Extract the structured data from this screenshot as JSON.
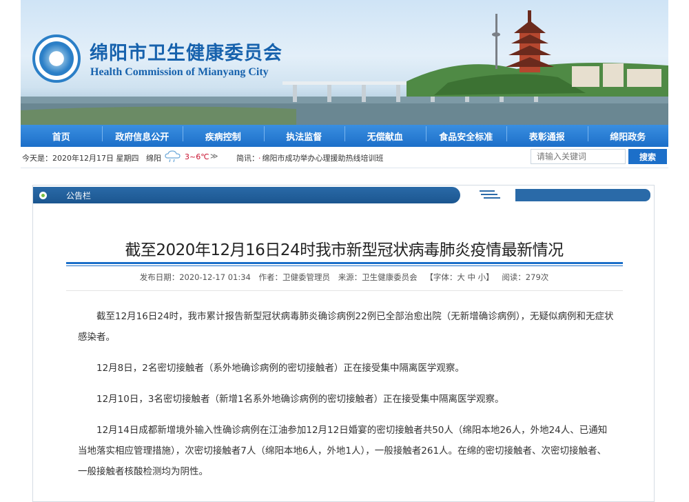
{
  "header": {
    "title_cn": "绵阳市卫生健康委员会",
    "title_en": "Health Commission of Mianyang City"
  },
  "nav": {
    "items": [
      "首页",
      "政府信息公开",
      "疾病控制",
      "执法监督",
      "无偿献血",
      "食品安全标准",
      "表彰通报",
      "绵阳政务"
    ]
  },
  "infobar": {
    "date": "今天是：2020年12月17日 星期四",
    "city": "绵阳",
    "temperature": "3~6℃",
    "more": "≫",
    "news_label": "简讯：",
    "news_text": "绵阳市成功举办心理援助热线培训班",
    "search_placeholder": "请输入关键词",
    "search_button": "搜索"
  },
  "panel": {
    "section_title": "公告栏"
  },
  "article": {
    "title": "截至2020年12月16日24时我市新型冠状病毒肺炎疫情最新情况",
    "meta": {
      "date": "发布日期：2020-12-17 01:34",
      "author": "作者：卫健委管理员",
      "source": "来源：卫生健康委员会",
      "font_size": "【字体：大 中 小】",
      "reads": "阅读：279次"
    },
    "paragraphs": [
      "截至12月16日24时，我市累计报告新型冠状病毒肺炎确诊病例22例已全部治愈出院（无新增确诊病例），无疑似病例和无症状感染者。",
      "12月8日，2名密切接触者（系外地确诊病例的密切接触者）正在接受集中隔离医学观察。",
      "12月10日，3名密切接触者（新增1名系外地确诊病例的密切接触者）正在接受集中隔离医学观察。",
      "12月14日成都新增境外输入性确诊病例在江油参加12月12日婚宴的密切接触者共50人（绵阳本地26人，外地24人、已通知当地落实相应管理措施），次密切接触者7人（绵阳本地6人，外地1人），一般接触者261人。在绵的密切接触者、次密切接触者、一般接触者核酸检测均为阴性。"
    ]
  },
  "colors": {
    "brand_blue": "#1c6fc9",
    "panel_header": "#1b5690",
    "temp_red": "#c8102e"
  }
}
